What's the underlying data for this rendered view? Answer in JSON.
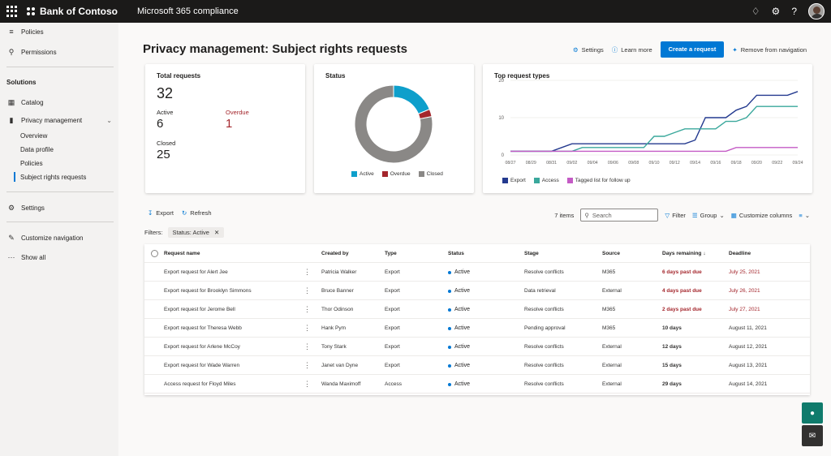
{
  "topbar": {
    "org_name": "Bank of Contoso",
    "product": "Microsoft 365 compliance",
    "icons": [
      "waffle-icon",
      "diamond-icon",
      "gear-icon",
      "help-icon",
      "avatar"
    ]
  },
  "sidebar": {
    "items_top": [
      {
        "label": "Policies",
        "icon": "policies-icon"
      },
      {
        "label": "Permissions",
        "icon": "key-icon"
      }
    ],
    "section": "Solutions",
    "solutions": [
      {
        "label": "Catalog",
        "icon": "catalog-icon"
      },
      {
        "label": "Privacy management",
        "icon": "privacy-icon"
      }
    ],
    "privacy_sub": [
      "Overview",
      "Data profile",
      "Policies",
      "Subject rights requests"
    ],
    "settings": "Settings",
    "customize": "Customize navigation",
    "show_all": "Show all"
  },
  "page": {
    "title": "Privacy management: Subject rights requests",
    "actions": {
      "settings": "Settings",
      "learn_more": "Learn more",
      "create": "Create a request",
      "remove": "Remove from navigation"
    }
  },
  "total_card": {
    "title": "Total requests",
    "total": "32",
    "active_label": "Active",
    "active": "6",
    "overdue_label": "Overdue",
    "overdue": "1",
    "closed_label": "Closed",
    "closed": "25"
  },
  "status_card": {
    "title": "Status",
    "legend": [
      "Active",
      "Overdue",
      "Closed"
    ]
  },
  "types_card": {
    "title": "Top request types",
    "legend": [
      "Export",
      "Access",
      "Tagged list for follow up"
    ]
  },
  "chart_data": [
    {
      "type": "pie",
      "title": "Status",
      "categories": [
        "Active",
        "Overdue",
        "Closed"
      ],
      "values": [
        6,
        1,
        25
      ],
      "colors": [
        "#0e9fcb",
        "#a4262c",
        "#8a8886"
      ]
    },
    {
      "type": "line",
      "title": "Top request types",
      "x": [
        "08/27",
        "08/28",
        "08/29",
        "08/30",
        "08/31",
        "09/01",
        "09/02",
        "09/03",
        "09/04",
        "09/05",
        "09/06",
        "09/07",
        "09/08",
        "09/09",
        "09/10",
        "09/11",
        "09/12",
        "09/13",
        "09/14",
        "09/15",
        "09/16",
        "09/17",
        "09/18",
        "09/19",
        "09/20",
        "09/21",
        "09/22",
        "09/23",
        "09/24"
      ],
      "x_tick_labels": [
        "08/27",
        "08/29",
        "08/31",
        "09/02",
        "09/04",
        "09/06",
        "09/08",
        "09/10",
        "09/12",
        "09/14",
        "09/16",
        "09/18",
        "09/20",
        "09/22",
        "09/24"
      ],
      "ylim": [
        0,
        20
      ],
      "y_ticks": [
        0,
        10,
        20
      ],
      "series": [
        {
          "name": "Export",
          "color": "#243a8f",
          "values": [
            1,
            1,
            1,
            1,
            1,
            2,
            3,
            3,
            3,
            3,
            3,
            3,
            3,
            3,
            3,
            3,
            3,
            3,
            4,
            10,
            10,
            10,
            12,
            13,
            16,
            16,
            16,
            16,
            17
          ]
        },
        {
          "name": "Access",
          "color": "#3aa89c",
          "values": [
            1,
            1,
            1,
            1,
            1,
            1,
            1,
            2,
            2,
            2,
            2,
            2,
            2,
            2,
            5,
            5,
            6,
            7,
            7,
            7,
            7,
            9,
            9,
            10,
            13,
            13,
            13,
            13,
            13
          ]
        },
        {
          "name": "Tagged list for follow up",
          "color": "#c45bc5",
          "values": [
            1,
            1,
            1,
            1,
            1,
            1,
            1,
            1,
            1,
            1,
            1,
            1,
            1,
            1,
            1,
            1,
            1,
            1,
            1,
            1,
            1,
            1,
            2,
            2,
            2,
            2,
            2,
            2,
            2
          ]
        }
      ]
    }
  ],
  "toolbar": {
    "export": "Export",
    "refresh": "Refresh",
    "count": "7 items",
    "search_placeholder": "Search",
    "filter": "Filter",
    "group": "Group",
    "customize": "Customize columns"
  },
  "filters": {
    "label": "Filters:",
    "chip": "Status: Active"
  },
  "table": {
    "columns": [
      "Request name",
      "Created by",
      "Type",
      "Status",
      "Stage",
      "Source",
      "Days remaining",
      "Deadline"
    ],
    "rows": [
      {
        "name": "Export request for Alert Jee",
        "created_by": "Patricia Walker",
        "type": "Export",
        "status": "Active",
        "stage": "Resolve conflicts",
        "source": "M365",
        "days": "6 days past due",
        "deadline": "July 25, 2021",
        "late": true
      },
      {
        "name": "Export request for Brooklyn Simmons",
        "created_by": "Bruce Banner",
        "type": "Export",
        "status": "Active",
        "stage": "Data retrieval",
        "source": "External",
        "days": "4 days past due",
        "deadline": "July 26, 2021",
        "late": true
      },
      {
        "name": "Export request for Jerome Bell",
        "created_by": "Thor Odinson",
        "type": "Export",
        "status": "Active",
        "stage": "Resolve conflicts",
        "source": "M365",
        "days": "2 days past due",
        "deadline": "July 27, 2021",
        "late": true
      },
      {
        "name": "Export request for Theresa Webb",
        "created_by": "Hank Pym",
        "type": "Export",
        "status": "Active",
        "stage": "Pending approval",
        "source": "M365",
        "days": "10 days",
        "deadline": "August 11, 2021",
        "late": false
      },
      {
        "name": "Export request for Arlene McCoy",
        "created_by": "Tony Stark",
        "type": "Export",
        "status": "Active",
        "stage": "Resolve conflicts",
        "source": "External",
        "days": "12 days",
        "deadline": "August 12, 2021",
        "late": false
      },
      {
        "name": "Export request for Wade Warren",
        "created_by": "Janet van Dyne",
        "type": "Export",
        "status": "Active",
        "stage": "Resolve conflicts",
        "source": "External",
        "days": "15 days",
        "deadline": "August 13, 2021",
        "late": false
      },
      {
        "name": "Access request for Floyd Miles",
        "created_by": "Wanda Maximoff",
        "type": "Access",
        "status": "Active",
        "stage": "Resolve conflicts",
        "source": "External",
        "days": "29 days",
        "deadline": "August 14, 2021",
        "late": false
      }
    ]
  },
  "colors": {
    "accent": "#0078d4",
    "danger": "#a4262c",
    "fab": "#0f7b6c",
    "topbar": "#1b1a19"
  }
}
